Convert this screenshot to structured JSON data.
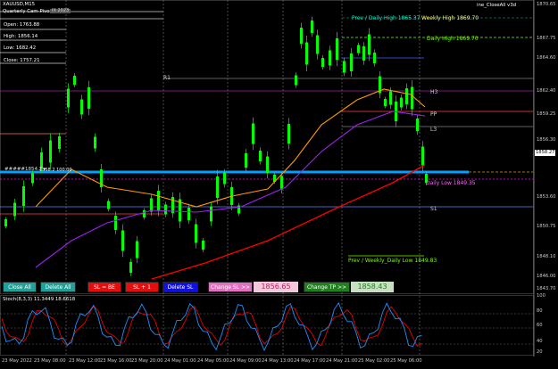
{
  "title": "XAUUSD,M15",
  "indicator_name": "Quarterly Cam-Pivots",
  "info_tag": "IX 2023",
  "top_right_label": "ine_CloseAll v3d",
  "ohlc": {
    "open": "Open: 1763.88",
    "high": "High: 1856.14",
    "low": "Low: 1682.42",
    "close": "Close: 1757.21"
  },
  "levels": {
    "prev_daily_high": "Prev / Daily High 1865.37",
    "weekly_high": "Weekly High 1869.70",
    "daily_high": "Daily High 1869.70",
    "r1": "R1",
    "h3": "H3",
    "pp": "PP",
    "l3": "L3",
    "s1": "S1",
    "daily_low": "Daily Low 1849.35",
    "prev_daily_low": "Prev / Weekly_Daily Low 1849.83",
    "left_marker": "#####1854.2 ▸",
    "small_value": "1858.2 100.00"
  },
  "buttons": {
    "close_all": "Close All",
    "delete_all": "Delete All",
    "sl_be": "SL = BE",
    "sl_plus1": "SL + 1",
    "delete_sl": "Delete SL",
    "change_sl": "Change SL >>",
    "change_sl_value": "1856.65",
    "change_tp": "Change TP >>",
    "change_tp_value": "1858.43"
  },
  "price_axis": {
    "labels": [
      "1870.65",
      "1867.75",
      "1864.60",
      "1862.40",
      "1859.25",
      "1856.30",
      "1853.60",
      "1850.75",
      "1848.10",
      "1846.00",
      "1843.70"
    ],
    "current_price": "1858.27"
  },
  "stoch": {
    "label": "Stoch(8,3,3) 11.3449 18.6618",
    "levels": [
      "100",
      "80",
      "60",
      "40",
      "20",
      "0"
    ]
  },
  "time_axis": [
    "23 May 2022",
    "23 May 08:00",
    "23 May 12:00",
    "23 May 16:00",
    "23 May 20:00",
    "24 May 01:00",
    "24 May 05:00",
    "24 May 09:00",
    "24 May 13:00",
    "24 May 17:00",
    "24 May 21:00",
    "25 May 02:00",
    "25 May 06:00"
  ],
  "colors": {
    "up_candle": "#00ff00",
    "down_candle": "#00ff00",
    "ma_red": "#ff0000",
    "ma_orange": "#ff9900",
    "ma_purple": "#a020f0",
    "cyan_line": "#00a0ff",
    "stoch_main": "#1e90ff",
    "stoch_signal": "#ff0000"
  }
}
